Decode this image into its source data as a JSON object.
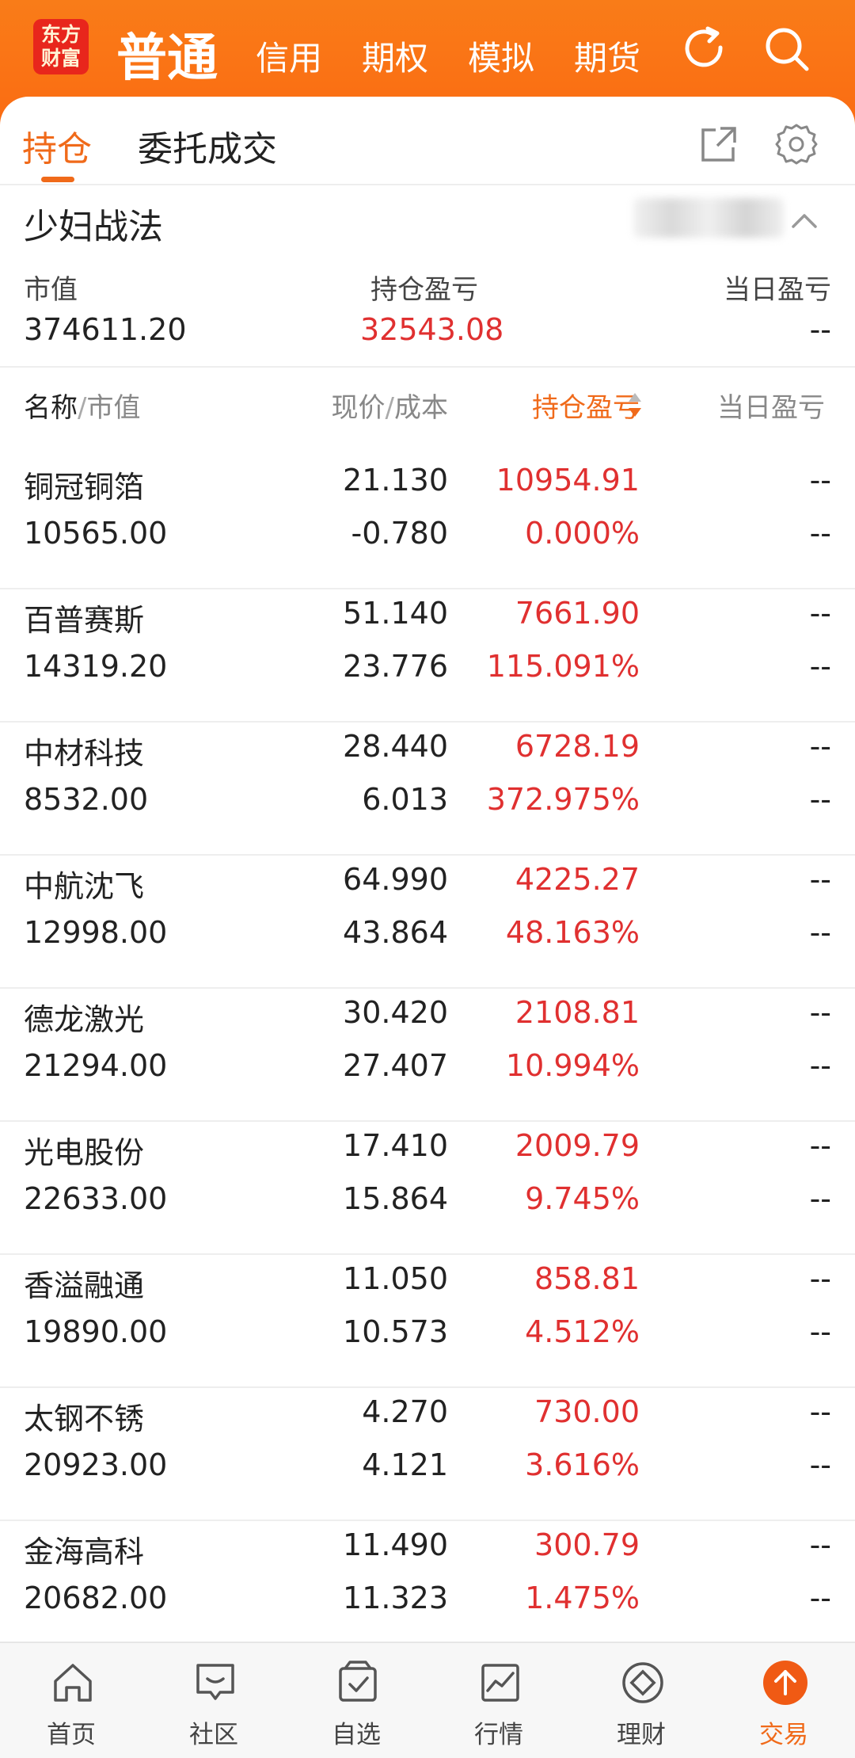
{
  "brand": {
    "logo_line1": "东方",
    "logo_line2": "财富",
    "accent": "#f06a1a",
    "header_bg": "#fb6a12"
  },
  "top_nav": {
    "active": "普通",
    "items": [
      "信用",
      "期权",
      "模拟",
      "期货"
    ],
    "icons": [
      "refresh-icon",
      "search-icon"
    ]
  },
  "tabs": {
    "active": "持仓",
    "other": "委托成交",
    "icons": [
      "share-icon",
      "settings-icon"
    ]
  },
  "account": {
    "name": "少妇战法"
  },
  "summary": {
    "market_value_label": "市值",
    "market_value": "374611.20",
    "pnl_label": "持仓盈亏",
    "pnl": "32543.08",
    "daily_label": "当日盈亏",
    "daily": "--"
  },
  "table_header": {
    "name": "名称",
    "slash1": "/",
    "value": "市值",
    "price": "现价",
    "slash2": "/",
    "cost": "成本",
    "pnl": "持仓盈亏",
    "daily": "当日盈亏"
  },
  "positions": [
    {
      "name": "铜冠铜箔",
      "value": "10565.00",
      "price": "21.130",
      "cost": "-0.780",
      "pnl": "10954.91",
      "pnl_pct": "0.000%",
      "daily": "--",
      "daily_pct": "--"
    },
    {
      "name": "百普赛斯",
      "value": "14319.20",
      "price": "51.140",
      "cost": "23.776",
      "pnl": "7661.90",
      "pnl_pct": "115.091%",
      "daily": "--",
      "daily_pct": "--"
    },
    {
      "name": "中材科技",
      "value": "8532.00",
      "price": "28.440",
      "cost": "6.013",
      "pnl": "6728.19",
      "pnl_pct": "372.975%",
      "daily": "--",
      "daily_pct": "--"
    },
    {
      "name": "中航沈飞",
      "value": "12998.00",
      "price": "64.990",
      "cost": "43.864",
      "pnl": "4225.27",
      "pnl_pct": "48.163%",
      "daily": "--",
      "daily_pct": "--"
    },
    {
      "name": "德龙激光",
      "value": "21294.00",
      "price": "30.420",
      "cost": "27.407",
      "pnl": "2108.81",
      "pnl_pct": "10.994%",
      "daily": "--",
      "daily_pct": "--"
    },
    {
      "name": "光电股份",
      "value": "22633.00",
      "price": "17.410",
      "cost": "15.864",
      "pnl": "2009.79",
      "pnl_pct": "9.745%",
      "daily": "--",
      "daily_pct": "--"
    },
    {
      "name": "香溢融通",
      "value": "19890.00",
      "price": "11.050",
      "cost": "10.573",
      "pnl": "858.81",
      "pnl_pct": "4.512%",
      "daily": "--",
      "daily_pct": "--"
    },
    {
      "name": "太钢不锈",
      "value": "20923.00",
      "price": "4.270",
      "cost": "4.121",
      "pnl": "730.00",
      "pnl_pct": "3.616%",
      "daily": "--",
      "daily_pct": "--"
    },
    {
      "name": "金海高科",
      "value": "20682.00",
      "price": "11.490",
      "cost": "11.323",
      "pnl": "300.79",
      "pnl_pct": "1.475%",
      "daily": "--",
      "daily_pct": "--"
    }
  ],
  "bottom_nav": [
    {
      "label": "首页",
      "icon": "home-icon"
    },
    {
      "label": "社区",
      "icon": "community-icon"
    },
    {
      "label": "自选",
      "icon": "watchlist-icon"
    },
    {
      "label": "行情",
      "icon": "market-chart-icon"
    },
    {
      "label": "理财",
      "icon": "wealth-icon"
    },
    {
      "label": "交易",
      "icon": "trade-icon"
    }
  ]
}
